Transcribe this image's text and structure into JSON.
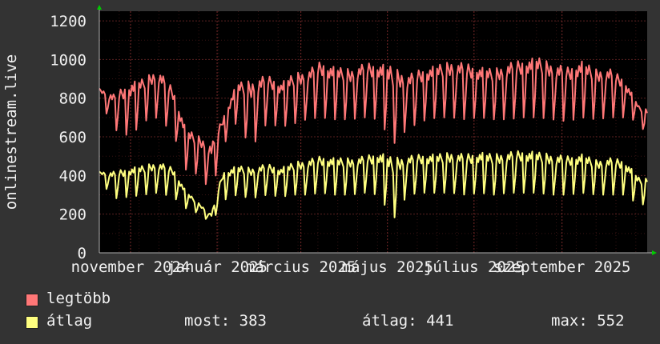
{
  "chart_data": {
    "type": "line",
    "ylabel": "onlinestream.live",
    "ylim": [
      0,
      1250
    ],
    "yticks": [
      0,
      200,
      400,
      600,
      800,
      1000,
      1200
    ],
    "xlim": [
      "2024-10-10",
      "2025-10-31"
    ],
    "xticks": [
      {
        "label": "november 2024",
        "date": "2024-11-01"
      },
      {
        "label": "január 2025",
        "date": "2025-01-01"
      },
      {
        "label": "március 2025",
        "date": "2025-03-01"
      },
      {
        "label": "május 2025",
        "date": "2025-05-01"
      },
      {
        "label": "július 2025",
        "date": "2025-07-01"
      },
      {
        "label": "szeptember 2025",
        "date": "2025-09-01"
      }
    ],
    "grid": true,
    "series": [
      {
        "name": "legtöbb",
        "color": "#ff7777",
        "points": [
          [
            "2024-10-10",
            850
          ],
          [
            "2024-10-20",
            820
          ],
          [
            "2024-11-01",
            880
          ],
          [
            "2024-11-10",
            900
          ],
          [
            "2024-11-20",
            950
          ],
          [
            "2024-12-01",
            850
          ],
          [
            "2024-12-10",
            640
          ],
          [
            "2024-12-20",
            600
          ],
          [
            "2024-12-28",
            560
          ],
          [
            "2025-01-05",
            700
          ],
          [
            "2025-01-15",
            880
          ],
          [
            "2025-01-25",
            890
          ],
          [
            "2025-02-05",
            920
          ],
          [
            "2025-02-15",
            880
          ],
          [
            "2025-02-25",
            930
          ],
          [
            "2025-03-05",
            940
          ],
          [
            "2025-03-15",
            990
          ],
          [
            "2025-03-25",
            960
          ],
          [
            "2025-04-05",
            950
          ],
          [
            "2025-04-15",
            980
          ],
          [
            "2025-04-25",
            980
          ],
          [
            "2025-05-05",
            960
          ],
          [
            "2025-05-15",
            920
          ],
          [
            "2025-05-25",
            950
          ],
          [
            "2025-06-05",
            970
          ],
          [
            "2025-06-15",
            990
          ],
          [
            "2025-06-25",
            980
          ],
          [
            "2025-07-05",
            960
          ],
          [
            "2025-07-15",
            950
          ],
          [
            "2025-07-25",
            980
          ],
          [
            "2025-08-05",
            1000
          ],
          [
            "2025-08-15",
            1010
          ],
          [
            "2025-08-25",
            980
          ],
          [
            "2025-09-05",
            960
          ],
          [
            "2025-09-15",
            990
          ],
          [
            "2025-09-25",
            950
          ],
          [
            "2025-10-05",
            950
          ],
          [
            "2025-10-15",
            900
          ],
          [
            "2025-10-25",
            760
          ],
          [
            "2025-10-31",
            740
          ]
        ],
        "min_points": [
          [
            "2024-10-10",
            800
          ],
          [
            "2024-10-20",
            640
          ],
          [
            "2024-11-01",
            600
          ],
          [
            "2024-11-10",
            680
          ],
          [
            "2024-11-20",
            700
          ],
          [
            "2024-12-01",
            620
          ],
          [
            "2024-12-10",
            430
          ],
          [
            "2024-12-20",
            400
          ],
          [
            "2024-12-28",
            310
          ],
          [
            "2025-01-05",
            550
          ],
          [
            "2025-01-15",
            680
          ],
          [
            "2025-01-25",
            540
          ],
          [
            "2025-02-05",
            670
          ],
          [
            "2025-02-15",
            650
          ],
          [
            "2025-02-25",
            670
          ],
          [
            "2025-03-05",
            690
          ],
          [
            "2025-03-15",
            700
          ],
          [
            "2025-03-25",
            690
          ],
          [
            "2025-04-05",
            690
          ],
          [
            "2025-04-15",
            700
          ],
          [
            "2025-04-25",
            690
          ],
          [
            "2025-05-05",
            560
          ],
          [
            "2025-05-15",
            640
          ],
          [
            "2025-05-25",
            680
          ],
          [
            "2025-06-05",
            700
          ],
          [
            "2025-06-15",
            700
          ],
          [
            "2025-06-25",
            690
          ],
          [
            "2025-07-05",
            700
          ],
          [
            "2025-07-15",
            690
          ],
          [
            "2025-07-25",
            690
          ],
          [
            "2025-08-05",
            700
          ],
          [
            "2025-08-15",
            700
          ],
          [
            "2025-08-25",
            690
          ],
          [
            "2025-09-05",
            680
          ],
          [
            "2025-09-15",
            700
          ],
          [
            "2025-09-25",
            690
          ],
          [
            "2025-10-05",
            700
          ],
          [
            "2025-10-15",
            700
          ],
          [
            "2025-10-25",
            680
          ],
          [
            "2025-10-31",
            600
          ]
        ]
      },
      {
        "name": "átlag",
        "color": "#ffff80",
        "points": [
          [
            "2024-10-10",
            420
          ],
          [
            "2024-10-20",
            420
          ],
          [
            "2024-11-01",
            440
          ],
          [
            "2024-11-10",
            450
          ],
          [
            "2024-11-20",
            470
          ],
          [
            "2024-12-01",
            440
          ],
          [
            "2024-12-10",
            320
          ],
          [
            "2024-12-20",
            250
          ],
          [
            "2024-12-28",
            200
          ],
          [
            "2025-01-05",
            420
          ],
          [
            "2025-01-15",
            450
          ],
          [
            "2025-01-25",
            440
          ],
          [
            "2025-02-05",
            460
          ],
          [
            "2025-02-15",
            440
          ],
          [
            "2025-02-25",
            470
          ],
          [
            "2025-03-05",
            480
          ],
          [
            "2025-03-15",
            500
          ],
          [
            "2025-03-25",
            490
          ],
          [
            "2025-04-05",
            490
          ],
          [
            "2025-04-15",
            500
          ],
          [
            "2025-04-25",
            520
          ],
          [
            "2025-05-05",
            490
          ],
          [
            "2025-05-15",
            500
          ],
          [
            "2025-05-25",
            510
          ],
          [
            "2025-06-05",
            510
          ],
          [
            "2025-06-15",
            520
          ],
          [
            "2025-06-25",
            510
          ],
          [
            "2025-07-05",
            520
          ],
          [
            "2025-07-15",
            510
          ],
          [
            "2025-07-25",
            520
          ],
          [
            "2025-08-05",
            530
          ],
          [
            "2025-08-15",
            520
          ],
          [
            "2025-08-25",
            510
          ],
          [
            "2025-09-05",
            500
          ],
          [
            "2025-09-15",
            510
          ],
          [
            "2025-09-25",
            480
          ],
          [
            "2025-10-05",
            490
          ],
          [
            "2025-10-15",
            480
          ],
          [
            "2025-10-25",
            390
          ],
          [
            "2025-10-31",
            383
          ]
        ],
        "min_points": [
          [
            "2024-10-10",
            380
          ],
          [
            "2024-10-20",
            280
          ],
          [
            "2024-11-01",
            290
          ],
          [
            "2024-11-10",
            300
          ],
          [
            "2024-11-20",
            310
          ],
          [
            "2024-12-01",
            290
          ],
          [
            "2024-12-10",
            230
          ],
          [
            "2024-12-20",
            200
          ],
          [
            "2024-12-28",
            150
          ],
          [
            "2025-01-05",
            270
          ],
          [
            "2025-01-15",
            300
          ],
          [
            "2025-01-25",
            280
          ],
          [
            "2025-02-05",
            300
          ],
          [
            "2025-02-15",
            290
          ],
          [
            "2025-02-25",
            300
          ],
          [
            "2025-03-05",
            300
          ],
          [
            "2025-03-15",
            310
          ],
          [
            "2025-03-25",
            300
          ],
          [
            "2025-04-05",
            300
          ],
          [
            "2025-04-15",
            310
          ],
          [
            "2025-04-25",
            300
          ],
          [
            "2025-05-05",
            170
          ],
          [
            "2025-05-15",
            300
          ],
          [
            "2025-05-25",
            310
          ],
          [
            "2025-06-05",
            310
          ],
          [
            "2025-06-15",
            310
          ],
          [
            "2025-06-25",
            300
          ],
          [
            "2025-07-05",
            310
          ],
          [
            "2025-07-15",
            300
          ],
          [
            "2025-07-25",
            310
          ],
          [
            "2025-08-05",
            310
          ],
          [
            "2025-08-15",
            310
          ],
          [
            "2025-08-25",
            300
          ],
          [
            "2025-09-05",
            300
          ],
          [
            "2025-09-15",
            310
          ],
          [
            "2025-09-25",
            300
          ],
          [
            "2025-10-05",
            300
          ],
          [
            "2025-10-15",
            300
          ],
          [
            "2025-10-25",
            250
          ],
          [
            "2025-10-31",
            250
          ]
        ]
      }
    ]
  },
  "legend": {
    "max_label": "legtöbb",
    "avg_label": "átlag",
    "max_color": "#ff7777",
    "avg_color": "#ffff80",
    "now_text": "most: 383",
    "avg_text": "átlag: 441",
    "peak_text": "max: 552"
  },
  "colors": {
    "background": "#333333",
    "plot_background": "#000000",
    "grid": "#5a2020",
    "axis": "#b0b0b0",
    "arrow": "#00cc00"
  }
}
